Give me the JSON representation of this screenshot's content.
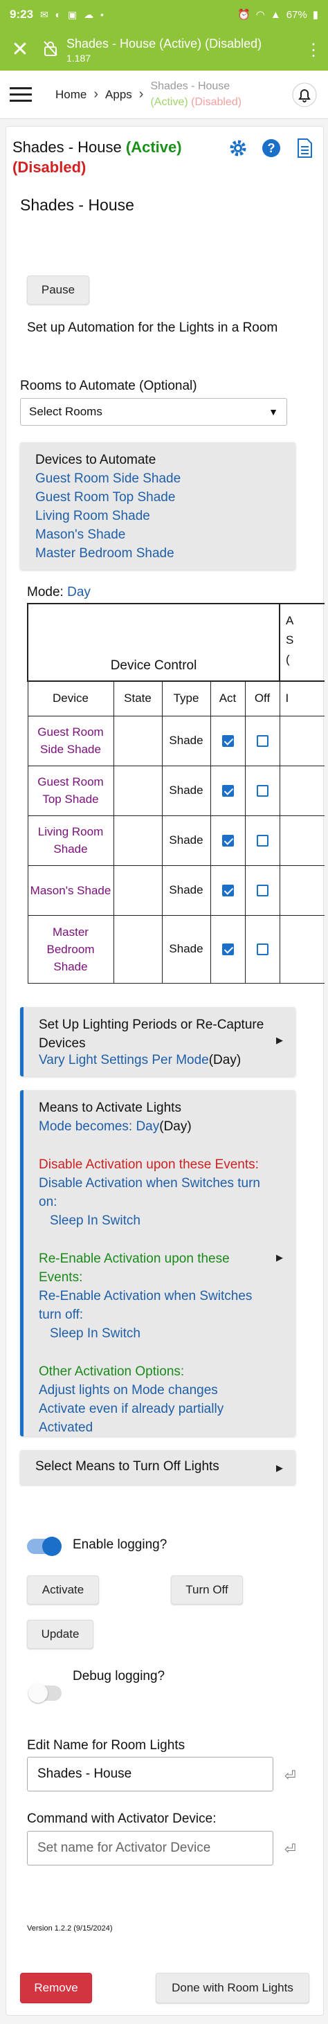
{
  "status_bar": {
    "time": "9:23",
    "battery": "67%"
  },
  "title_bar": {
    "title": "Shades - House (Active) (Disabled)",
    "subtitle": "1.187"
  },
  "breadcrumb": {
    "home": "Home",
    "apps": "Apps",
    "current_main": "Shades - House",
    "current_active": "(Active)",
    "current_disabled": "(Disabled)"
  },
  "app": {
    "name": "Shades - House",
    "active_label": "(Active)",
    "disabled_label": "(Disabled)",
    "section_title": "Shades - House",
    "pause_label": "Pause",
    "setup_text": "Set up Automation for the Lights in a Room",
    "rooms_label": "Rooms to Automate",
    "rooms_optional": "(Optional)",
    "rooms_select": "Select Rooms",
    "devices_title": "Devices to Automate",
    "devices": [
      "Guest Room Side Shade",
      "Guest Room Top Shade",
      "Living Room Shade",
      "Mason's Shade",
      "Master Bedroom Shade"
    ],
    "mode_label": "Mode:",
    "mode_value": "Day"
  },
  "device_table": {
    "group_header": "Device Control",
    "side_header_lines": [
      "A",
      "S",
      "("
    ],
    "side_col_cell": "I",
    "columns": [
      "Device",
      "State",
      "Type",
      "Act",
      "Off"
    ],
    "rows": [
      {
        "device": "Guest Room Side Shade",
        "state": "",
        "type": "Shade",
        "act": true,
        "off": false
      },
      {
        "device": "Guest Room Top Shade",
        "state": "",
        "type": "Shade",
        "act": true,
        "off": false
      },
      {
        "device": "Living Room Shade",
        "state": "",
        "type": "Shade",
        "act": true,
        "off": false
      },
      {
        "device": "Mason's Shade",
        "state": "",
        "type": "Shade",
        "act": true,
        "off": false
      },
      {
        "device": "Master Bedroom Shade",
        "state": "",
        "type": "Shade",
        "act": true,
        "off": false
      }
    ]
  },
  "lighting_periods": {
    "title": "Set Up Lighting Periods or Re-Capture Devices",
    "link": "Vary Light Settings Per Mode",
    "suffix": "(Day)"
  },
  "means_activate": {
    "title": "Means to Activate Lights",
    "mode_link": "Mode becomes: Day",
    "mode_suffix": "(Day)",
    "disable_heading": "Disable Activation upon these Events:",
    "disable_text": "Disable Activation when Switches turn on:",
    "disable_switch": "Sleep In Switch",
    "reenable_heading": "Re-Enable Activation upon these Events:",
    "reenable_text": "Re-Enable Activation when Switches turn off:",
    "reenable_switch": "Sleep In Switch",
    "other_heading": "Other Activation Options:",
    "other_1": "Adjust lights on Mode changes",
    "other_2": "Activate even if already partially Activated"
  },
  "turn_off": {
    "title": "Select Means to Turn Off Lights"
  },
  "controls": {
    "enable_logging": "Enable logging?",
    "enable_logging_on": true,
    "activate": "Activate",
    "turn_off": "Turn Off",
    "update": "Update",
    "debug_logging": "Debug logging?",
    "debug_logging_on": false
  },
  "edit_name": {
    "label": "Edit Name for Room Lights",
    "value": "Shades - House"
  },
  "activator": {
    "label": "Command with Activator Device:",
    "placeholder": "Set name for Activator Device"
  },
  "footer": {
    "version": "Version 1.2.2 (9/15/2024)",
    "remove": "Remove",
    "done": "Done with Room Lights"
  },
  "colors": {
    "header_green": "#8dc43a",
    "link_blue": "#1f5fa8",
    "accent_blue": "#1a6fc9",
    "active_green": "#1a8f1a",
    "disabled_red": "#d32020",
    "device_purple": "#7a0f7a",
    "remove_red": "#d3343f"
  }
}
